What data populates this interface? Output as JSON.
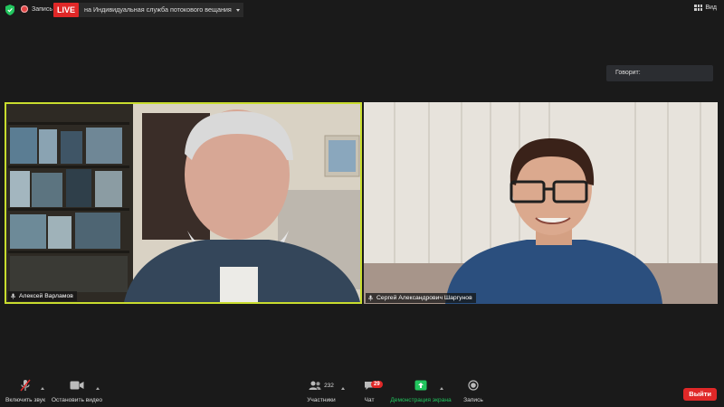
{
  "topbar": {
    "record_label": "Запись",
    "live_label": "LIVE",
    "stream_label": "на Индивидуальная служба потокового вещания",
    "view_label": "Вид"
  },
  "speaker_panel": {
    "label": "Говорит:"
  },
  "tiles": [
    {
      "name": "Алексей Варламов",
      "active_speaker": true,
      "highlight_color": "#c8dc2e"
    },
    {
      "name": "Сергей Александрович Шаргунов",
      "active_speaker": false
    }
  ],
  "toolbar": {
    "mute_label": "Включить звук",
    "video_label": "Остановить видео",
    "participants_label": "Участники",
    "participants_count": "232",
    "chat_label": "Чат",
    "chat_badge": "29",
    "share_label": "Демонстрация экрана",
    "record_label": "Запись",
    "leave_label": "Выйти"
  },
  "colors": {
    "live_red": "#e02828",
    "share_green": "#22c55e",
    "background": "#1a1a1a"
  }
}
